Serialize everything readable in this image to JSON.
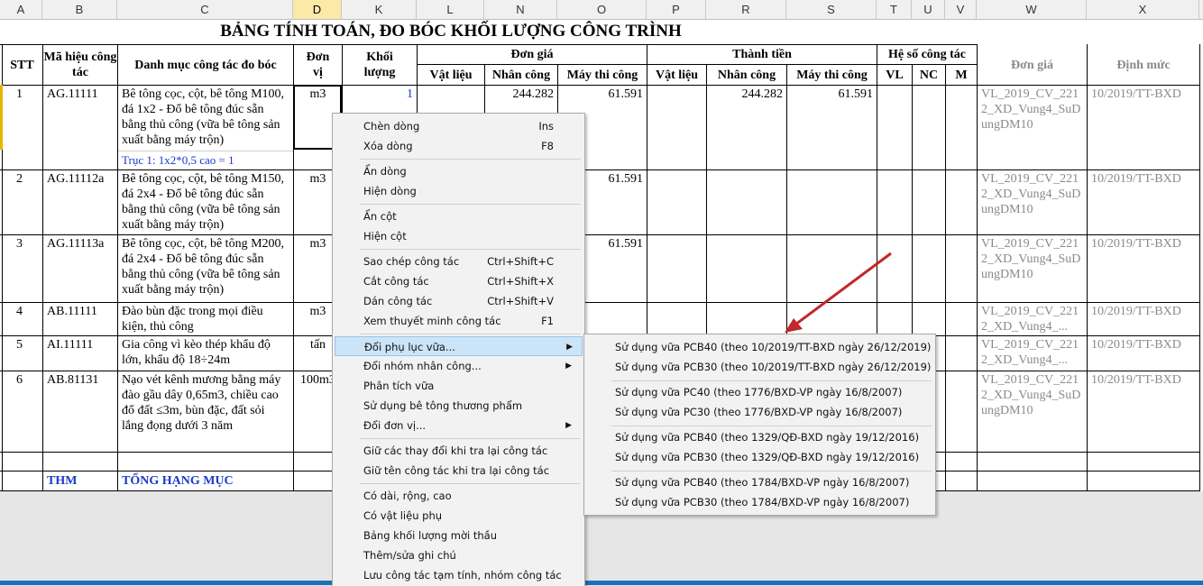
{
  "columns": [
    "A",
    "B",
    "C",
    "D",
    "K",
    "L",
    "N",
    "O",
    "P",
    "R",
    "S",
    "T",
    "U",
    "V",
    "W",
    "X"
  ],
  "title": "BẢNG TÍNH TOÁN, ĐO BÓC KHỐI LƯỢNG CÔNG TRÌNH",
  "headers": {
    "stt": "STT",
    "code": "Mã hiệu công tác",
    "name": "Danh mục công tác đo bóc",
    "unit": "Đơn vị",
    "qty": "Khối lượng",
    "unit_price": "Đơn giá",
    "total": "Thành tiền",
    "coef": "Hệ số công tác",
    "vl": "Vật liệu",
    "nc": "Nhân công",
    "mtc": "Máy thi công",
    "vl2": "Vật liệu",
    "nc2": "Nhân công",
    "mtc2": "Máy thi công",
    "c_vl": "VL",
    "c_nc": "NC",
    "c_m": "M",
    "price_src": "Đơn giá",
    "norm": "Định mức"
  },
  "rows": [
    {
      "stt": "1",
      "code": "AG.11111",
      "name": "Bê tông cọc, cột, bê tông M100, đá 1x2 - Đổ bê tông đúc sẵn bằng thủ công (vữa bê tông sản xuất bằng máy trộn)",
      "unit": "m3",
      "qty": "1",
      "nc": "244.282",
      "mtc": "61.591",
      "nc2": "244.282",
      "mtc2": "61.591",
      "price_src": "VL_2019_CV_2212_XD_Vung4_SuDungDM10",
      "norm": "10/2019/TT-BXD"
    },
    {
      "stt": "2",
      "code": "AG.11112a",
      "name": "Bê tông cọc, cột, bê tông M150, đá 2x4 - Đổ bê tông đúc sẵn bằng thủ công (vữa bê tông sản xuất bằng máy trộn)",
      "unit": "m3",
      "mtc": "61.591",
      "price_src": "VL_2019_CV_2212_XD_Vung4_SuDungDM10",
      "norm": "10/2019/TT-BXD"
    },
    {
      "stt": "3",
      "code": "AG.11113a",
      "name": "Bê tông cọc, cột, bê tông M200, đá 2x4 - Đổ bê tông đúc sẵn bằng thủ công (vữa bê tông sản xuất bằng máy trộn)",
      "unit": "m3",
      "mtc": "61.591",
      "price_src": "VL_2019_CV_2212_XD_Vung4_SuDungDM10",
      "norm": "10/2019/TT-BXD"
    },
    {
      "stt": "4",
      "code": "AB.11111",
      "name": "Đào bùn đặc trong mọi điều kiện, thủ công",
      "unit": "m3",
      "price_src": "VL_2019_CV_2212_XD_Vung4_...",
      "norm": "10/2019/TT-BXD"
    },
    {
      "stt": "5",
      "code": "AI.11111",
      "name": "Gia công vì kèo thép khẩu độ lớn, khẩu độ 18÷24m",
      "unit": "tấn",
      "price_src": "VL_2019_CV_2212_XD_Vung4_...",
      "norm": "10/2019/TT-BXD"
    },
    {
      "stt": "6",
      "code": "AB.81131",
      "name": "Nạo vét kênh mương bằng máy đào gầu dây 0,65m3, chiều cao đổ đất ≤3m, bùn đặc, đất sỏi lắng đọng dưới 3 năm",
      "unit": "100m3",
      "price_src": "VL_2019_CV_2212_XD_Vung4_SuDungDM10",
      "norm": "10/2019/TT-BXD"
    }
  ],
  "formula": "Trục 1: 1x2*0,5 cao = 1",
  "total_row": {
    "code": "THM",
    "name": "TỔNG HẠNG MỤC"
  },
  "context_menu": [
    {
      "label": "Chèn dòng",
      "shortcut": "Ins"
    },
    {
      "label": "Xóa dòng",
      "shortcut": "F8"
    },
    {
      "label": "Ẩn dòng"
    },
    {
      "label": "Hiện dòng"
    },
    {
      "label": "Ẩn cột"
    },
    {
      "label": "Hiện cột"
    },
    {
      "label": "Sao chép công tác",
      "shortcut": "Ctrl+Shift+C"
    },
    {
      "label": "Cắt công tác",
      "shortcut": "Ctrl+Shift+X"
    },
    {
      "label": "Dán công tác",
      "shortcut": "Ctrl+Shift+V"
    },
    {
      "label": "Xem thuyết minh công tác",
      "shortcut": "F1"
    },
    {
      "label": "Đổi phụ lục vữa..."
    },
    {
      "label": "Đổi nhóm nhân công..."
    },
    {
      "label": "Phân tích vữa"
    },
    {
      "label": "Sử dụng bê tông thương phẩm"
    },
    {
      "label": "Đổi đơn vị..."
    },
    {
      "label": "Giữ các thay đổi khi tra lại công tác"
    },
    {
      "label": "Giữ tên công tác khi tra lại công tác"
    },
    {
      "label": "Có dài, rộng, cao"
    },
    {
      "label": "Có vật liệu phụ"
    },
    {
      "label": "Bảng khối lượng mời thầu"
    },
    {
      "label": "Thêm/sửa ghi chú"
    },
    {
      "label": "Lưu công tác tạm tính, nhóm công tác"
    }
  ],
  "submenu": [
    "Sử dụng vữa PCB40 (theo 10/2019/TT-BXD ngày 26/12/2019)",
    "Sử dụng vữa PCB30 (theo 10/2019/TT-BXD ngày 26/12/2019)",
    "Sử dụng vữa PC40 (theo 1776/BXD-VP ngày 16/8/2007)",
    "Sử dụng vữa PC30 (theo 1776/BXD-VP ngày 16/8/2007)",
    "Sử dụng vữa PCB40 (theo 1329/QĐ-BXD ngày 19/12/2016)",
    "Sử dụng vữa PCB30 (theo 1329/QĐ-BXD ngày 19/12/2016)",
    "Sử dụng vữa PCB40 (theo 1784/BXD-VP ngày 16/8/2007)",
    "Sử dụng vữa PCB30 (theo 1784/BXD-VP ngày 16/8/2007)"
  ],
  "colors": {
    "selected_col": "#fbe9a8",
    "menu_highlight": "#cce4f7",
    "arrow": "#c0282b",
    "link_blue": "#1a3acb"
  }
}
